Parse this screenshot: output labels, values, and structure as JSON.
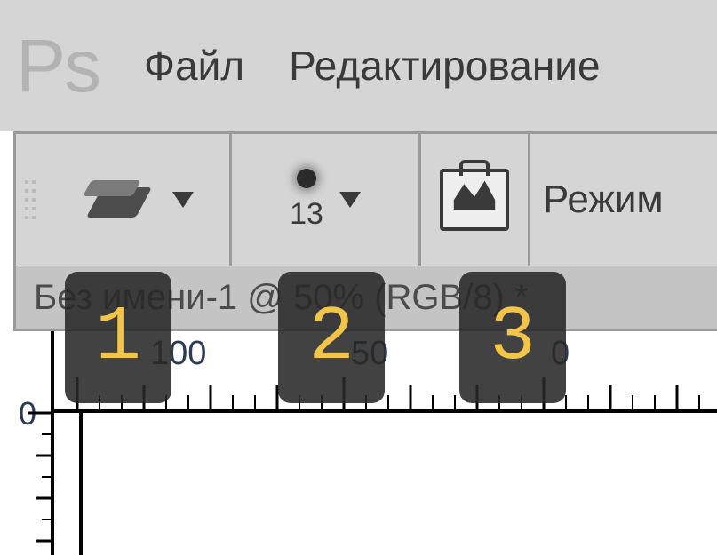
{
  "app": {
    "logo_text": "Ps"
  },
  "menu": {
    "file": "Файл",
    "edit": "Редактирование"
  },
  "options": {
    "tool_name": "eraser",
    "brush_size": "13",
    "mode_label": "Режим"
  },
  "document": {
    "tab_title": "Без имени-1 @ 50% (RGB/8) *"
  },
  "ruler": {
    "labels": [
      "100",
      "50",
      "0"
    ],
    "origin_label": "0"
  },
  "annotations": {
    "a1": "1",
    "a2": "2",
    "a3": "3"
  }
}
